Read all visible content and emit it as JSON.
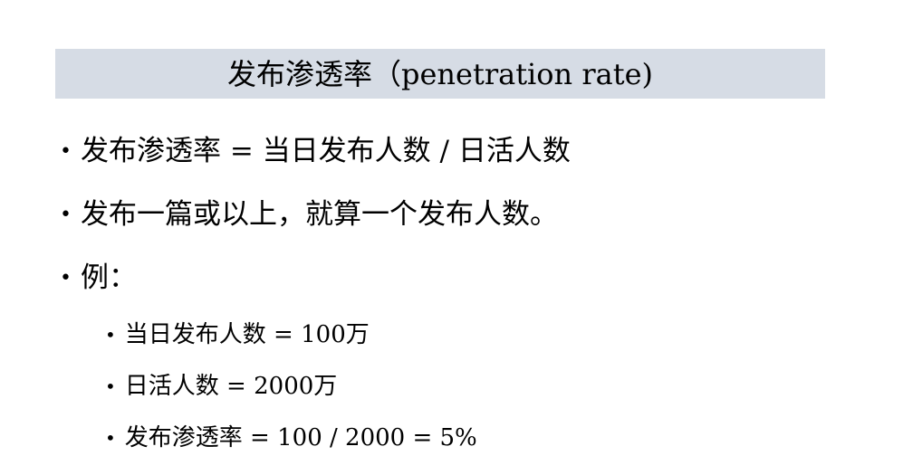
{
  "title": "发布渗透率（penetration rate)",
  "bullets": [
    {
      "text": "发布渗透率 = 当日发布人数 / 日活人数"
    },
    {
      "text": "发布一篇或以上，就算一个发布人数。"
    },
    {
      "text": "例："
    }
  ],
  "sub_bullets": [
    {
      "text": "当日发布人数 = 100万"
    },
    {
      "text": "日活人数 = 2000万"
    },
    {
      "text": "发布渗透率 = 100 / 2000 = 5%"
    }
  ],
  "bullet_glyph": "•",
  "colors": {
    "title_bar_bg": "#d6dce5",
    "text": "#000000",
    "background": "#ffffff"
  }
}
